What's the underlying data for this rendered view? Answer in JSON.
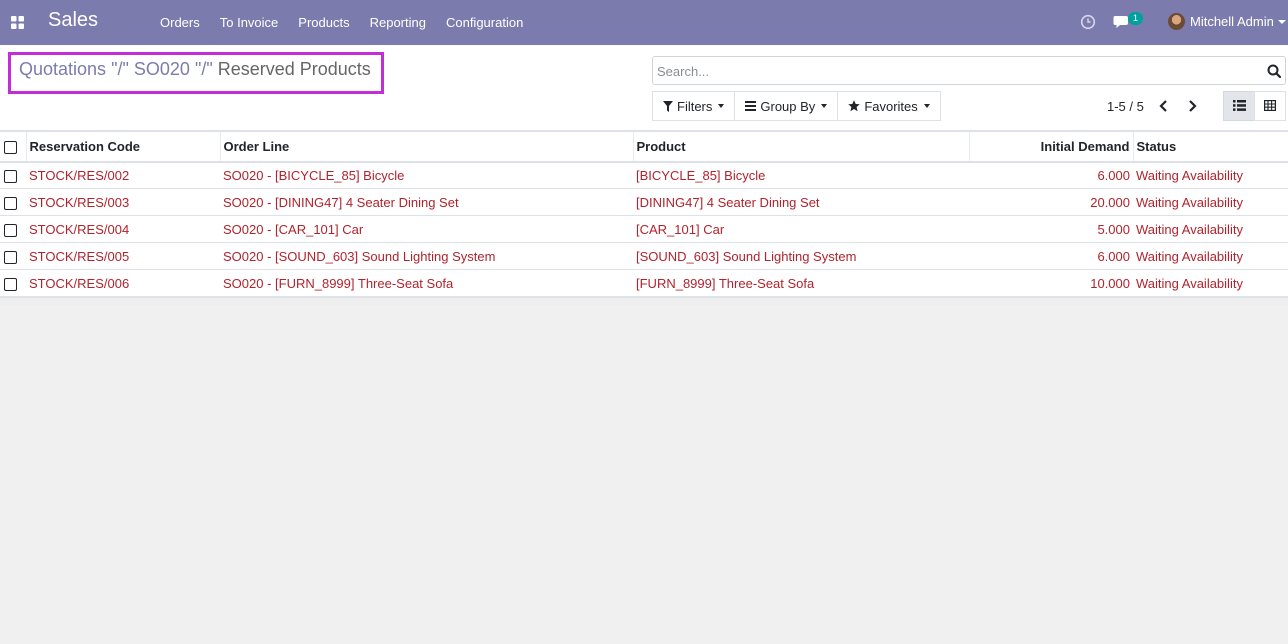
{
  "navbar": {
    "app_name": "Sales",
    "menu": [
      "Orders",
      "To Invoice",
      "Products",
      "Reporting",
      "Configuration"
    ],
    "chat_count": "1",
    "user_name": "Mitchell Admin"
  },
  "breadcrumb": {
    "items": [
      "Quotations",
      "SO020"
    ],
    "separator": "\"/\"",
    "active": "Reserved Products"
  },
  "search": {
    "placeholder": "Search..."
  },
  "filters": {
    "filters_label": "Filters",
    "group_by_label": "Group By",
    "favorites_label": "Favorites"
  },
  "pager": {
    "text": "1-5 / 5"
  },
  "table": {
    "headers": {
      "reservation_code": "Reservation Code",
      "order_line": "Order Line",
      "product": "Product",
      "initial_demand": "Initial Demand",
      "status": "Status"
    },
    "rows": [
      {
        "code": "STOCK/RES/002",
        "order_line": "SO020 - [BICYCLE_85] Bicycle",
        "product": "[BICYCLE_85] Bicycle",
        "demand": "6.000",
        "status": "Waiting Availability"
      },
      {
        "code": "STOCK/RES/003",
        "order_line": "SO020 - [DINING47] 4 Seater Dining Set",
        "product": "[DINING47] 4 Seater Dining Set",
        "demand": "20.000",
        "status": "Waiting Availability"
      },
      {
        "code": "STOCK/RES/004",
        "order_line": "SO020 - [CAR_101] Car",
        "product": "[CAR_101] Car",
        "demand": "5.000",
        "status": "Waiting Availability"
      },
      {
        "code": "STOCK/RES/005",
        "order_line": "SO020 - [SOUND_603] Sound Lighting System",
        "product": "[SOUND_603] Sound Lighting System",
        "demand": "6.000",
        "status": "Waiting Availability"
      },
      {
        "code": "STOCK/RES/006",
        "order_line": "SO020 - [FURN_8999] Three-Seat Sofa",
        "product": "[FURN_8999] Three-Seat Sofa",
        "demand": "10.000",
        "status": "Waiting Availability"
      }
    ]
  },
  "colors": {
    "navbar": "#7c7bad",
    "link": "#b1232c",
    "highlight_box": "#c32cd6",
    "badge": "#00a09d"
  },
  "icons": [
    "apps-grid-icon",
    "clock-icon",
    "chat-icon",
    "search-icon",
    "filter-icon",
    "group-by-icon",
    "star-icon",
    "chevron-left-icon",
    "chevron-right-icon",
    "list-view-icon",
    "pivot-view-icon"
  ]
}
